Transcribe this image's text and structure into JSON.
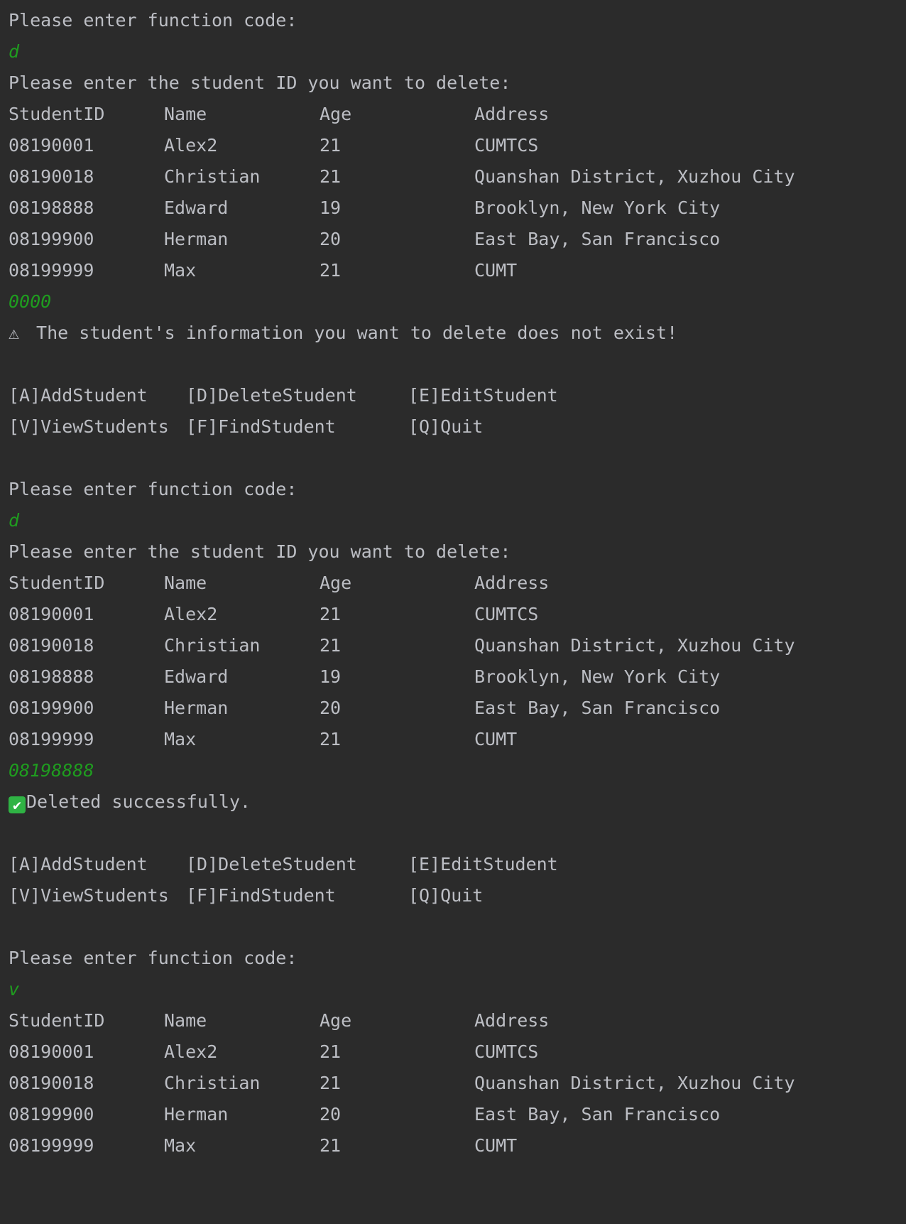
{
  "session1": {
    "prompt": "Please enter function code:",
    "input_code": "d",
    "delete_prompt": "Please enter the student ID you want to delete:",
    "table": {
      "headers": [
        "StudentID",
        "Name",
        "Age",
        "Address"
      ],
      "rows": [
        [
          "08190001",
          "Alex2",
          "21",
          "CUMTCS"
        ],
        [
          "08190018",
          "Christian",
          "21",
          "Quanshan District, Xuzhou City"
        ],
        [
          "08198888",
          "Edward",
          "19",
          "Brooklyn, New York City"
        ],
        [
          "08199900",
          "Herman",
          "20",
          "East Bay, San Francisco"
        ],
        [
          "08199999",
          "Max",
          "21",
          "CUMT"
        ]
      ]
    },
    "input_id": "0000",
    "result_icon": "⚠",
    "result_text": " The student's information you want to delete does not exist!",
    "menu": {
      "row1": [
        "[A]AddStudent",
        "[D]DeleteStudent",
        "[E]EditStudent"
      ],
      "row2": [
        "[V]ViewStudents",
        "[F]FindStudent",
        "[Q]Quit"
      ]
    }
  },
  "session2": {
    "prompt": "Please enter function code:",
    "input_code": "d",
    "delete_prompt": "Please enter the student ID you want to delete:",
    "table": {
      "headers": [
        "StudentID",
        "Name",
        "Age",
        "Address"
      ],
      "rows": [
        [
          "08190001",
          "Alex2",
          "21",
          "CUMTCS"
        ],
        [
          "08190018",
          "Christian",
          "21",
          "Quanshan District, Xuzhou City"
        ],
        [
          "08198888",
          "Edward",
          "19",
          "Brooklyn, New York City"
        ],
        [
          "08199900",
          "Herman",
          "20",
          "East Bay, San Francisco"
        ],
        [
          "08199999",
          "Max",
          "21",
          "CUMT"
        ]
      ]
    },
    "input_id": "08198888",
    "result_icon": "✔",
    "result_text": "Deleted successfully.",
    "menu": {
      "row1": [
        "[A]AddStudent",
        "[D]DeleteStudent",
        "[E]EditStudent"
      ],
      "row2": [
        "[V]ViewStudents",
        "[F]FindStudent",
        "[Q]Quit"
      ]
    }
  },
  "session3": {
    "prompt": "Please enter function code:",
    "input_code": "v",
    "table": {
      "headers": [
        "StudentID",
        "Name",
        "Age",
        "Address"
      ],
      "rows": [
        [
          "08190001",
          "Alex2",
          "21",
          "CUMTCS"
        ],
        [
          "08190018",
          "Christian",
          "21",
          "Quanshan District, Xuzhou City"
        ],
        [
          "08199900",
          "Herman",
          "20",
          "East Bay, San Francisco"
        ],
        [
          "08199999",
          "Max",
          "21",
          "CUMT"
        ]
      ]
    }
  },
  "colors": {
    "background": "#2b2b2b",
    "text": "#bcbec4",
    "user_input": "#1f9c1f",
    "success_icon_bg": "#2fb344"
  }
}
